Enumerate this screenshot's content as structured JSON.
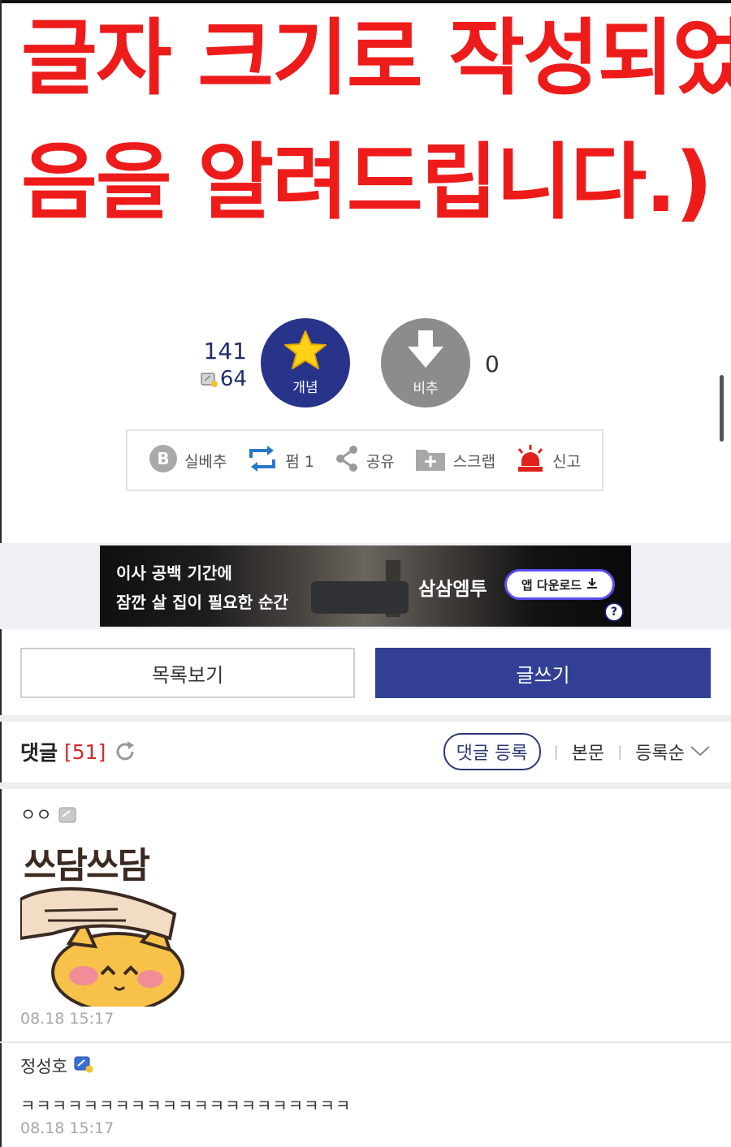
{
  "headline": {
    "line1": "글자 크기로 작성되었",
    "line2": "음을 알려드립니다.)",
    "color": "#ee1b1b"
  },
  "vote": {
    "up_count": "141",
    "fixed_count": "64",
    "up_label": "개념",
    "down_label": "비추",
    "down_count": "0",
    "up_color": "#28348a",
    "down_color": "#8c8c8c"
  },
  "actions": {
    "best": "실베추",
    "repost": "펌 1",
    "share": "공유",
    "scrap": "스크랩",
    "report": "신고"
  },
  "ad": {
    "line1": "이사 공백 기간에",
    "line2": "잠깐 살 집이 필요한 순간",
    "brand": "삼삼엠투",
    "download": "앱 다운로드",
    "info": "?"
  },
  "buttons": {
    "list": "목록보기",
    "write": "글쓰기",
    "write_color": "#323f94"
  },
  "comments_header": {
    "title": "댓글",
    "count": "[51]",
    "register": "댓글 등록",
    "body": "본문",
    "sort": "등록순"
  },
  "comments": [
    {
      "author": "ㅇㅇ",
      "sticker_text": "쓰담쓰담",
      "time": "08.18 15:17"
    },
    {
      "author": "정성호",
      "text": "ㅋㅋㅋㅋㅋㅋㅋㅋㅋㅋㅋㅋㅋㅋㅋㅋㅋㅋㅋㅋㅋ",
      "time": "08.18 15:17"
    }
  ]
}
